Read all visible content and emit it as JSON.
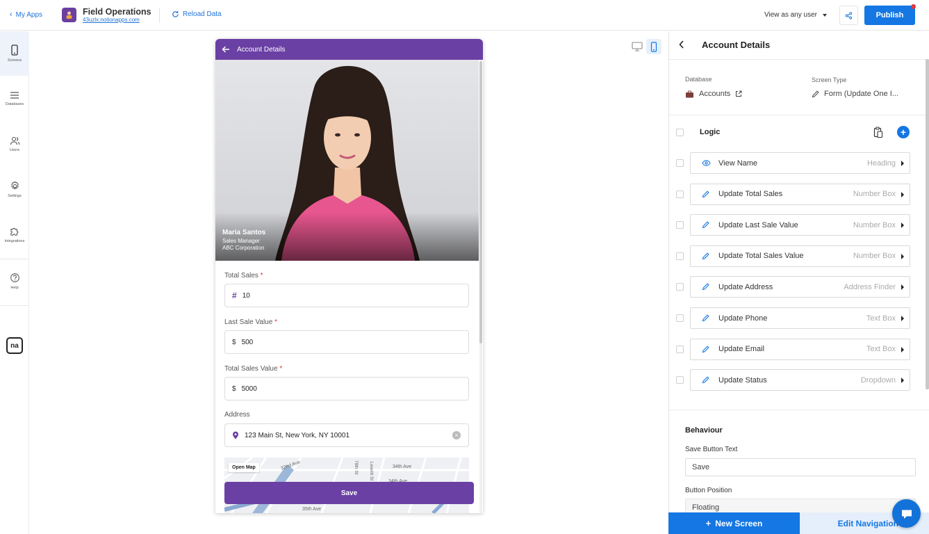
{
  "topbar": {
    "my_apps": "My Apps",
    "app_title": "Field Operations",
    "app_url": "43uzlx.notionapps.com",
    "reload": "Reload Data",
    "view_as": "View as any user",
    "publish": "Publish"
  },
  "leftnav": {
    "items": [
      {
        "label": "Screens",
        "icon": "mobile-icon",
        "active": true
      },
      {
        "label": "Databases",
        "icon": "list-icon"
      },
      {
        "label": "Users",
        "icon": "users-icon"
      },
      {
        "label": "Settings",
        "icon": "gear-icon"
      },
      {
        "label": "Integrations",
        "icon": "puzzle-icon"
      },
      {
        "label": "Help",
        "icon": "help-icon"
      }
    ],
    "logo": "na"
  },
  "phone": {
    "header_title": "Account Details",
    "profile": {
      "name": "Maria Santos",
      "role": "Sales Manager",
      "company": "ABC Corporation"
    },
    "fields": [
      {
        "label": "Total Sales",
        "required": "*",
        "prefix": "#",
        "value": "10"
      },
      {
        "label": "Last Sale Value",
        "required": "*",
        "prefix": "$",
        "value": "500"
      },
      {
        "label": "Total Sales Value",
        "required": "*",
        "prefix": "$",
        "value": "5000"
      },
      {
        "label": "Address",
        "required": "",
        "prefix": "",
        "value": "123 Main St, New York, NY 10001"
      }
    ],
    "map": {
      "open_map": "Open Map",
      "streets": [
        "32nd Ave",
        "34th Ave",
        "35th Ave",
        "78th St",
        "Leavitt St"
      ]
    },
    "save": "Save"
  },
  "panel": {
    "title": "Account Details",
    "database_label": "Database",
    "database_value": "Accounts",
    "screen_type_label": "Screen Type",
    "screen_type_value": "Form (Update One I...",
    "logic_label": "Logic",
    "logic_rows": [
      {
        "name": "View Name",
        "type": "Heading",
        "icon": "eye-icon"
      },
      {
        "name": "Update Total Sales",
        "type": "Number Box",
        "icon": "pencil-icon"
      },
      {
        "name": "Update Last Sale Value",
        "type": "Number Box",
        "icon": "pencil-icon"
      },
      {
        "name": "Update Total Sales Value",
        "type": "Number Box",
        "icon": "pencil-icon"
      },
      {
        "name": "Update Address",
        "type": "Address Finder",
        "icon": "pencil-icon"
      },
      {
        "name": "Update Phone",
        "type": "Text Box",
        "icon": "pencil-icon"
      },
      {
        "name": "Update Email",
        "type": "Text Box",
        "icon": "pencil-icon"
      },
      {
        "name": "Update Status",
        "type": "Dropdown",
        "icon": "pencil-icon"
      }
    ],
    "behaviour": "Behaviour",
    "save_button_text_label": "Save Button Text",
    "save_button_text_value": "Save",
    "button_position_label": "Button Position",
    "button_position_value": "Floating"
  },
  "bottom": {
    "new_screen": "New Screen",
    "edit_navigation": "Edit Navigation"
  },
  "colors": {
    "brand_purple": "#6a40a4",
    "accent_blue": "#1477e3",
    "alert_red": "#e23b3b"
  }
}
